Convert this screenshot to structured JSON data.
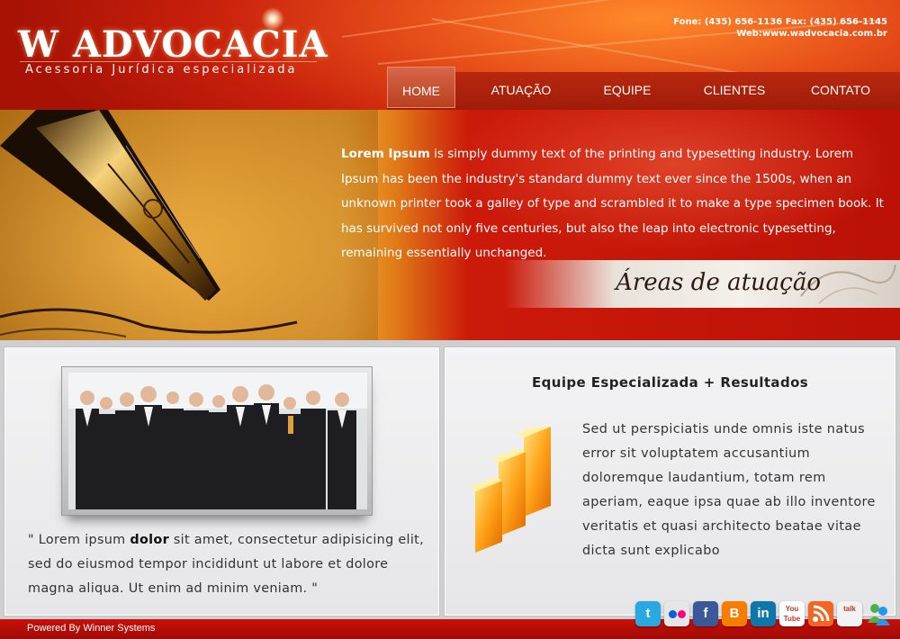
{
  "header": {
    "logo_title": "W ADVOCACIA",
    "logo_subtitle": "Acessoria Jurídica especializada",
    "phone_line": "Fone: (435) 656-1136 Fax: (435) 656-1145",
    "web_line": "Web:www.wadvocacia.com.br"
  },
  "nav": {
    "items": [
      {
        "label": "HOME",
        "active": true
      },
      {
        "label": "ATUAÇÃO",
        "active": false
      },
      {
        "label": "EQUIPE",
        "active": false
      },
      {
        "label": "CLIENTES",
        "active": false
      },
      {
        "label": "CONTATO",
        "active": false
      }
    ]
  },
  "banner": {
    "intro_bold": "Lorem Ipsum",
    "intro_text": " is simply dummy text of the printing and typesetting industry. Lorem Ipsum has been the industry's standard dummy text ever since the 1500s, when an unknown printer took a galley of type and scrambled it to make a type specimen book. It has survived not only five centuries, but also the leap into electronic typesetting, remaining essentially unchanged.",
    "areas_label": "Áreas de atuação"
  },
  "left_panel": {
    "quote_start": "\" Lorem ipsum ",
    "quote_bold": "dolor",
    "quote_end": " sit amet, consectetur adipisicing elit, sed do eiusmod tempor incididunt ut labore et dolore magna aliqua. Ut enim ad minim veniam. \""
  },
  "right_panel": {
    "title": "Equipe Especializada + Resultados",
    "text": "Sed ut perspiciatis unde omnis iste natus error sit voluptatem accusantium doloremque laudantium, totam rem aperiam, eaque ipsa quae ab illo inventore veritatis et quasi architecto beatae vitae dicta sunt explicabo"
  },
  "footer": {
    "powered_by": "Powered By Winner Systems"
  },
  "social": [
    {
      "icon": "twitter-icon",
      "label": "t",
      "color": "#2aa9e0"
    },
    {
      "icon": "flickr-icon",
      "label": "",
      "color": "#e6e6e6"
    },
    {
      "icon": "facebook-icon",
      "label": "f",
      "color": "#3b5998"
    },
    {
      "icon": "blogger-icon",
      "label": "B",
      "color": "#f57d00"
    },
    {
      "icon": "linkedin-icon",
      "label": "in",
      "color": "#0e76a8"
    },
    {
      "icon": "youtube-icon",
      "label": "You Tube",
      "color": "#ffffff"
    },
    {
      "icon": "rss-icon",
      "label": "",
      "color": "#f26522"
    },
    {
      "icon": "gtalk-icon",
      "label": "talk",
      "color": "#f2f2f2"
    },
    {
      "icon": "messenger-icon",
      "label": "",
      "color": "#5cb85c"
    }
  ]
}
